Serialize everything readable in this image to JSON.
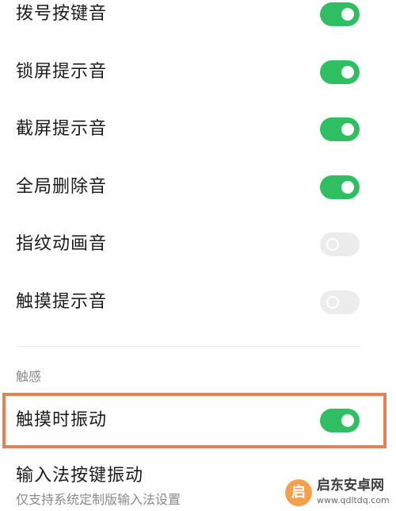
{
  "settings": {
    "rows": [
      {
        "label": "拨号按键音",
        "state": "on"
      },
      {
        "label": "锁屏提示音",
        "state": "on"
      },
      {
        "label": "截屏提示音",
        "state": "on"
      },
      {
        "label": "全局删除音",
        "state": "on"
      },
      {
        "label": "指纹动画音",
        "state": "off"
      },
      {
        "label": "触摸提示音",
        "state": "off"
      }
    ]
  },
  "haptics": {
    "section_title": "触感",
    "touch_vibration": {
      "label": "触摸时振动",
      "state": "on"
    },
    "ime_vibration": {
      "title": "输入法按键振动",
      "subtitle": "仅支持系统定制版输入法设置"
    }
  },
  "watermark": {
    "logo_glyph": "启",
    "title": "启东安卓网",
    "url": "www.qdltdq.com"
  },
  "colors": {
    "toggle_on": "#2fbf62",
    "toggle_off": "#ececec",
    "highlight": "#e6804f"
  }
}
